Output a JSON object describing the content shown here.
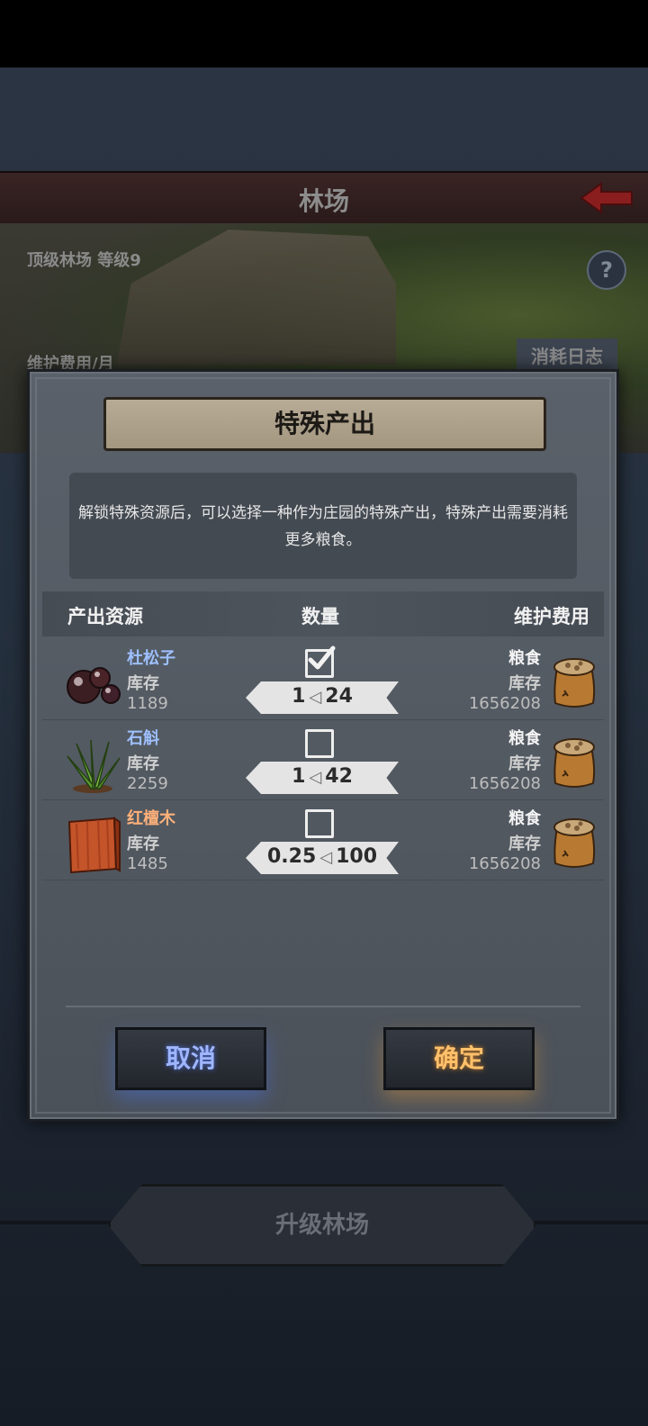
{
  "header": {
    "title": "林场"
  },
  "building": {
    "level_text": "顶级林场 等级9",
    "maintenance_label": "维护费用/月",
    "log_button": "消耗日志",
    "help_symbol": "?"
  },
  "upgrade_button": "升级林场",
  "dialog": {
    "title": "特殊产出",
    "description": "解锁特殊资源后，可以选择一种作为庄园的特殊产出，特殊产出需要消耗更多粮食。",
    "headers": {
      "resource": "产出资源",
      "quantity": "数量",
      "cost": "维护费用"
    },
    "rows": [
      {
        "name": "杜松子",
        "name_color": "#9ec0ff",
        "stock_label": "库存",
        "stock": "1189",
        "checked": true,
        "amount": "1",
        "cost_value": "24",
        "cost_name": "粮食",
        "cost_stock_label": "库存",
        "cost_stock": "1656208",
        "icon": "juniper-berries-icon"
      },
      {
        "name": "石斛",
        "name_color": "#9ec0ff",
        "stock_label": "库存",
        "stock": "2259",
        "checked": false,
        "amount": "1",
        "cost_value": "42",
        "cost_name": "粮食",
        "cost_stock_label": "库存",
        "cost_stock": "1656208",
        "icon": "dendrobium-grass-icon"
      },
      {
        "name": "红檀木",
        "name_color": "#ffb07a",
        "stock_label": "库存",
        "stock": "1485",
        "checked": false,
        "amount": "0.25",
        "cost_value": "100",
        "cost_name": "粮食",
        "cost_stock_label": "库存",
        "cost_stock": "1656208",
        "icon": "red-sandalwood-icon"
      }
    ],
    "cancel_button": "取消",
    "confirm_button": "确定"
  }
}
